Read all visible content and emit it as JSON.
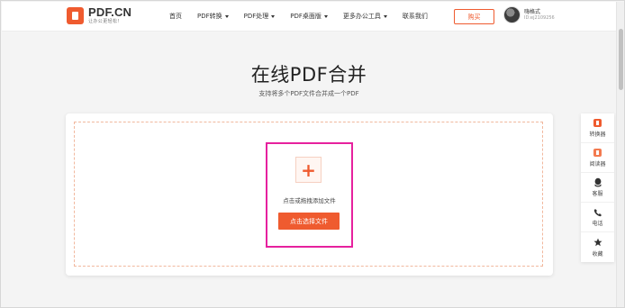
{
  "header": {
    "logo": {
      "name": "PDF.CN",
      "slogan": "让办公更轻松！"
    },
    "nav": [
      {
        "label": "首页",
        "has_dropdown": false
      },
      {
        "label": "PDF转换",
        "has_dropdown": true
      },
      {
        "label": "PDF处理",
        "has_dropdown": true
      },
      {
        "label": "PDF桌面版",
        "has_dropdown": true
      },
      {
        "label": "更多办公工具",
        "has_dropdown": true
      },
      {
        "label": "联系我们",
        "has_dropdown": false
      }
    ],
    "buy_label": "购买",
    "user": {
      "name": "嗨格式",
      "id": "ID:ej2109256"
    }
  },
  "main": {
    "title": "在线PDF合并",
    "subtitle": "支持将多个PDF文件合并成一个PDF",
    "upload": {
      "plus": "+",
      "hint": "点击或拖拽添加文件",
      "button_label": "点击选择文件"
    }
  },
  "side_toolbar": [
    {
      "label": "转换器",
      "icon": "converter-icon"
    },
    {
      "label": "阅读器",
      "icon": "reader-icon"
    },
    {
      "label": "客服",
      "icon": "service-icon"
    },
    {
      "label": "电话",
      "icon": "phone-icon"
    },
    {
      "label": "收藏",
      "icon": "star-icon"
    }
  ],
  "colors": {
    "accent": "#ef5b2f",
    "highlight": "#e6219e",
    "dashed_border": "#f1b89e",
    "background": "#f4f4f4"
  }
}
